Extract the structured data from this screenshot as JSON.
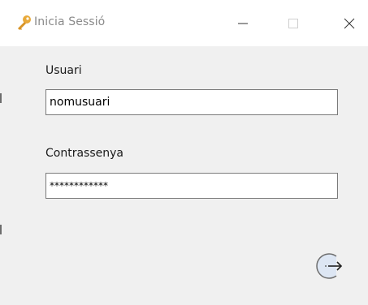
{
  "window": {
    "title": "Inicia Sessió",
    "icon": "key-icon",
    "controls": {
      "minimize_icon": "minimize-icon",
      "maximize_icon": "maximize-icon",
      "close_icon": "close-icon"
    }
  },
  "form": {
    "username": {
      "label": "Usuari",
      "value": "nomusuari"
    },
    "password": {
      "label": "Contrassenya",
      "value": "************"
    },
    "submit": {
      "icon": "login-arrow-icon"
    }
  },
  "colors": {
    "titlebar": "#ffffff",
    "background": "#f0f0f0",
    "key_icon": "#e8a93a",
    "button_ring": "#6e6e6e",
    "button_fill": "#dde6f3"
  }
}
